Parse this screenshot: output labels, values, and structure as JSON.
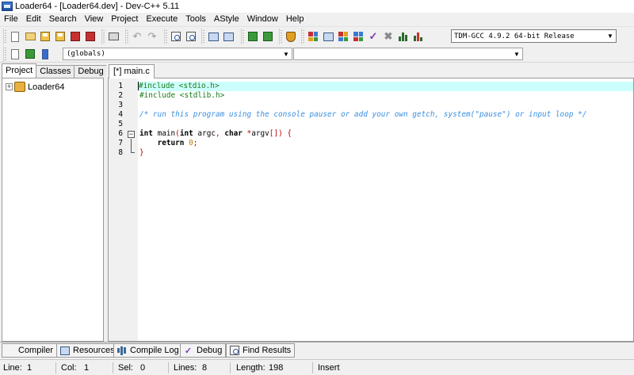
{
  "window": {
    "title": "Loader64 - [Loader64.dev] - Dev-C++ 5.11"
  },
  "menu": [
    "File",
    "Edit",
    "Search",
    "View",
    "Project",
    "Execute",
    "Tools",
    "AStyle",
    "Window",
    "Help"
  ],
  "toolbar": {
    "compiler": "TDM-GCC 4.9.2 64-bit Release",
    "class_browser_scope": "(globals)",
    "class_browser_member": ""
  },
  "left_panel": {
    "tabs": [
      "Project",
      "Classes",
      "Debug"
    ],
    "active_tab": "Project",
    "tree": {
      "expander": "+",
      "root": "Loader64"
    }
  },
  "editor": {
    "tab_label": "[*] main.c",
    "current_line": 1,
    "fold_toggle": "−",
    "lines": [
      {
        "num": "1",
        "text": "#include <stdio.h>"
      },
      {
        "num": "2",
        "text": "#include <stdlib.h>"
      },
      {
        "num": "3",
        "text": ""
      },
      {
        "num": "4",
        "text": "/* run this program using the console pauser or add your own getch, system(\"pause\") or input loop */"
      },
      {
        "num": "5",
        "text": ""
      },
      {
        "num": "6",
        "text": "int main(int argc, char *argv[]) {"
      },
      {
        "num": "7",
        "text": "    return 0;"
      },
      {
        "num": "8",
        "text": "}"
      }
    ]
  },
  "bottom_tabs": [
    "Compiler",
    "Resources",
    "Compile Log",
    "Debug",
    "Find Results"
  ],
  "status": {
    "line_label": "Line:",
    "line_value": "1",
    "col_label": "Col:",
    "col_value": "1",
    "sel_label": "Sel:",
    "sel_value": "0",
    "lines_label": "Lines:",
    "lines_value": "8",
    "length_label": "Length:",
    "length_value": "198",
    "mode": "Insert"
  }
}
